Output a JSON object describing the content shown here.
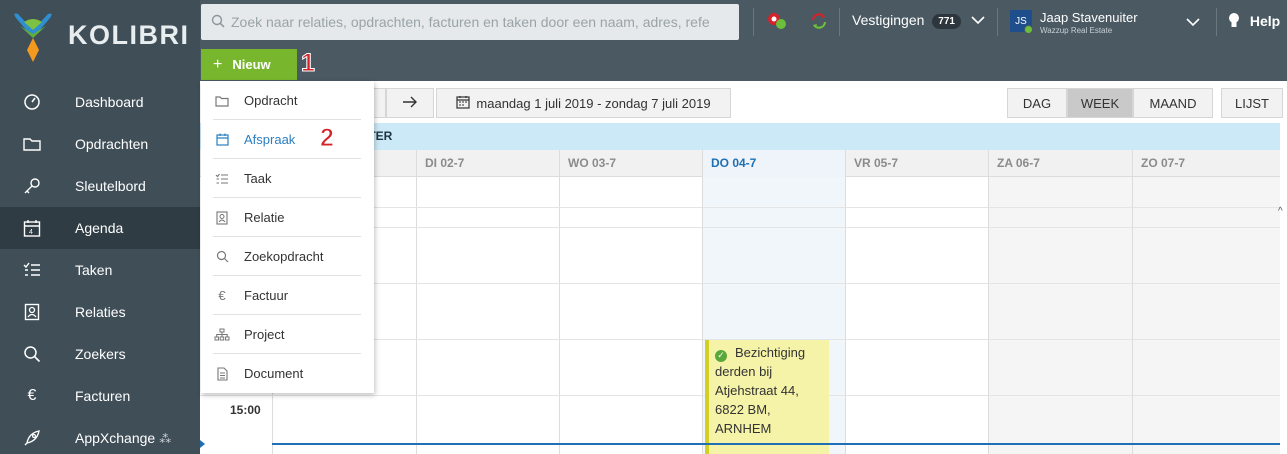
{
  "app": {
    "logo_text": "KOLIBRI"
  },
  "sidebar": {
    "items": [
      {
        "label": "Dashboard",
        "icon": "gauge-icon"
      },
      {
        "label": "Opdrachten",
        "icon": "folder-icon"
      },
      {
        "label": "Sleutelbord",
        "icon": "key-icon"
      },
      {
        "label": "Agenda",
        "icon": "calendar-icon",
        "active": true
      },
      {
        "label": "Taken",
        "icon": "checklist-icon"
      },
      {
        "label": "Relaties",
        "icon": "contact-card-icon"
      },
      {
        "label": "Zoekers",
        "icon": "search-icon"
      },
      {
        "label": "Facturen",
        "icon": "euro-icon"
      },
      {
        "label": "AppXchange",
        "icon": "rocket-icon"
      }
    ]
  },
  "topbar": {
    "search_placeholder": "Zoek naar relaties, opdrachten, facturen en taken door een naam, adres, refe",
    "vestigingen_label": "Vestigingen",
    "vestigingen_count": "771",
    "avatar_initials": "JS",
    "user_name": "Jaap Stavenuiter",
    "user_org": "Wazzup Real Estate",
    "help_label": "Help",
    "new_button_label": "Nieuw"
  },
  "callouts": {
    "first": "1",
    "second": "2"
  },
  "toolbar": {
    "date_range": "maandag 1 juli 2019 - zondag 7 juli 2019",
    "views": [
      "DAG",
      "WEEK",
      "MAAND",
      "LIJST"
    ],
    "active_view": "WEEK"
  },
  "dropdown": {
    "items": [
      {
        "label": "Opdracht",
        "icon": "folder-icon"
      },
      {
        "label": "Afspraak",
        "icon": "calendar-icon",
        "active": true
      },
      {
        "label": "Taak",
        "icon": "checklist-icon"
      },
      {
        "label": "Relatie",
        "icon": "contact-card-icon"
      },
      {
        "label": "Zoekopdracht",
        "icon": "search-icon"
      },
      {
        "label": "Factuur",
        "icon": "euro-icon"
      },
      {
        "label": "Project",
        "icon": "org-chart-icon"
      },
      {
        "label": "Document",
        "icon": "document-icon"
      }
    ]
  },
  "calendar": {
    "user_row_visible": "ITER",
    "days": [
      "DI 02-7",
      "WO 03-7",
      "DO 04-7",
      "VR 05-7",
      "ZA 06-7",
      "ZO 07-7"
    ],
    "today": "DO 04-7",
    "time_label": "15:00",
    "event": {
      "title": "Bezichtiging derden bij Atjehstraat 44, 6822 BM, ARNHEM"
    }
  },
  "colors": {
    "sidebar": "#3f4e57",
    "topbar": "#4a5962",
    "accent_green": "#78b72d",
    "today_blue": "#1e6fb3",
    "event_yellow": "#f5f3a8",
    "callout_red": "#d5232a"
  }
}
